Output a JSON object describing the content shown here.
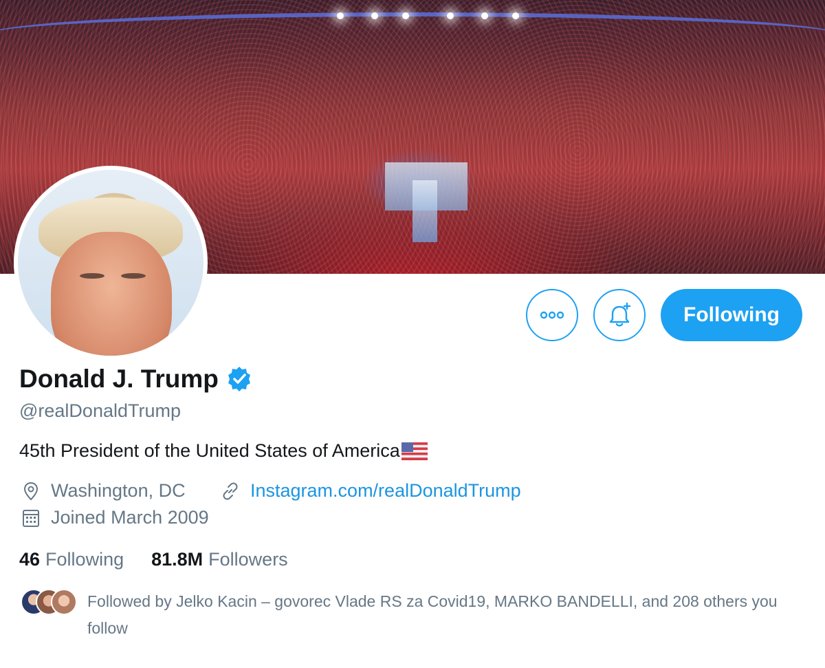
{
  "profile": {
    "name": "Donald J. Trump",
    "handle": "@realDonaldTrump",
    "bio": "45th President of the United States of America",
    "location": "Washington, DC",
    "website": "Instagram.com/realDonaldTrump",
    "joined": "Joined March 2009"
  },
  "actions": {
    "more_icon": "more-icon",
    "notify_icon": "bell-plus-icon",
    "follow_label": "Following"
  },
  "stats": {
    "following_count": "46",
    "following_label": "Following",
    "followers_count": "81.8M",
    "followers_label": "Followers"
  },
  "followed_by": {
    "text": "Followed by Jelko Kacin – govorec Vlade RS za Covid19, MARKO BANDELLI, and 208 others you follow"
  },
  "colors": {
    "accent": "#1da1f2",
    "secondary_text": "#657786",
    "link": "#1b95e0"
  }
}
